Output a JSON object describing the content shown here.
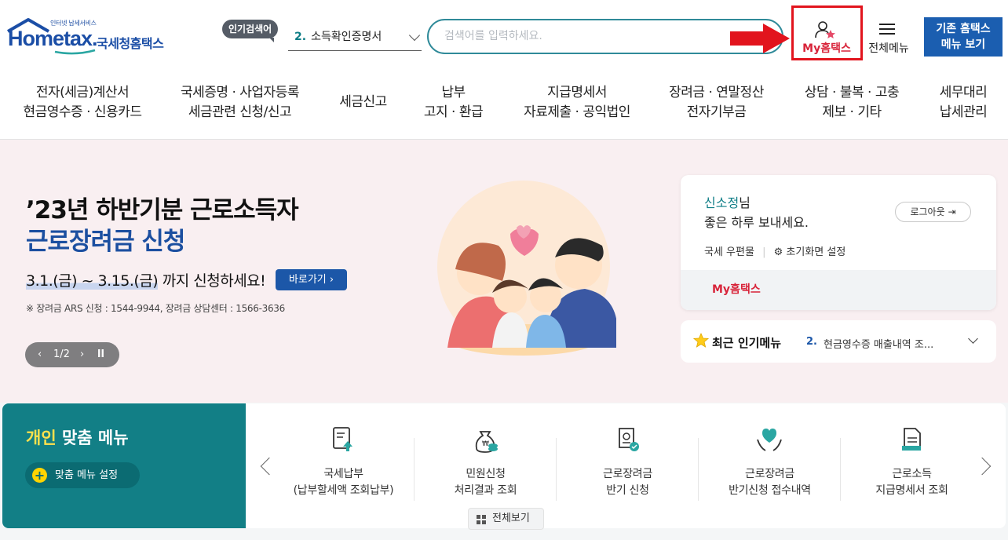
{
  "header": {
    "logo_tag": "인터넷 납세서비스",
    "logo_main": "Hometax.",
    "logo_sub": "국세청홈택스",
    "popular_tag": "인기검색어",
    "popular_num": "2.",
    "popular_text": "소득확인증명서",
    "search_placeholder": "검색어를 입력하세요.",
    "my_hometax": "My홈택스",
    "full_menu": "전체메뉴",
    "legacy_menu_line1": "기존 홈택스",
    "legacy_menu_line2": "메뉴 보기"
  },
  "gnb": [
    {
      "label": "전자(세금)계산서\n현금영수증 · 신용카드"
    },
    {
      "label": "국세증명 · 사업자등록\n세금관련 신청/신고"
    },
    {
      "label": "세금신고"
    },
    {
      "label": "납부\n고지 · 환급"
    },
    {
      "label": "지급명세서\n자료제출 · 공익법인"
    },
    {
      "label": "장려금 · 연말정산\n전자기부금"
    },
    {
      "label": "상담 · 불복 · 고충\n제보 · 기타"
    },
    {
      "label": "세무대리\n납세관리"
    }
  ],
  "hero": {
    "line1": "’23년 하반기분 근로소득자",
    "line2": "근로장려금 신청",
    "date_range": "3.1.(금) ~ 3.15.(금)",
    "date_suffix": " 까지 신청하세요!",
    "go_button": "바로가기",
    "note": "※ 장려금 ARS 신청 : 1544-9944, 장려금 상담센터 : 1566-3636",
    "pager": "1/2"
  },
  "user_card": {
    "name": "신소정",
    "name_suffix": "님",
    "greeting": "좋은 하루 보내세요.",
    "logout": "로그아웃",
    "postbox": "국세 우편물",
    "reset": "초기화면 설정",
    "my_hometax": "My홈택스"
  },
  "recent_menu": {
    "title": "최근 인기메뉴",
    "num": "2.",
    "text": "현금영수증 매출내역 조..."
  },
  "personal_menu": {
    "title_highlight": "개인",
    "title_rest": " 맞춤 메뉴",
    "settings": "맞춤 메뉴 설정",
    "items": [
      {
        "label": "국세납부\n(납부할세액 조회납부)",
        "icon": "tax-payment-icon"
      },
      {
        "label": "민원신청\n처리결과 조회",
        "icon": "money-bag-icon"
      },
      {
        "label": "근로장려금\n반기 신청",
        "icon": "document-badge-icon"
      },
      {
        "label": "근로장려금\n반기신청 접수내역",
        "icon": "hands-heart-icon"
      },
      {
        "label": "근로소득\n지급명세서 조회",
        "icon": "document-stack-icon"
      }
    ],
    "view_all": "전체보기"
  },
  "colors": {
    "brand_blue": "#1b4ea6",
    "teal": "#127f86",
    "highlight_red": "#e2141d"
  }
}
